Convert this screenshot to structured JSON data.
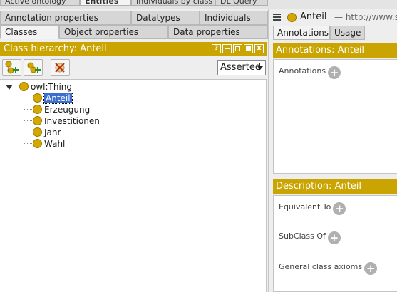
{
  "top_tabs": [
    "Active ontology",
    "Entities",
    "Individuals by class",
    "DL Query"
  ],
  "left": {
    "tabs_row1": [
      "Annotation properties",
      "Datatypes",
      "Individuals"
    ],
    "tabs_row2": [
      "Classes",
      "Object properties",
      "Data properties"
    ],
    "title": "Class hierarchy: Anteil",
    "title_icons": [
      "?",
      "",
      "",
      "",
      "x"
    ],
    "view_select": "Asserted",
    "tree": {
      "root": "owl:Thing",
      "children": [
        "Anteil",
        "Erzeugung",
        "Investitionen",
        "Jahr",
        "Wahl"
      ],
      "selected": "Anteil"
    }
  },
  "right": {
    "entity_name": "Anteil",
    "entity_iri": "— http://www.ser",
    "tabs": [
      "Annotations",
      "Usage"
    ],
    "annotations_title": "Annotations: Anteil",
    "annotations_label": "Annotations",
    "description_title": "Description: Anteil",
    "description_items": [
      "Equivalent To",
      "SubClass Of",
      "General class axioms"
    ]
  },
  "colors": {
    "accent": "#caa400",
    "class_icon": "#d4a800",
    "selection": "#3a6fcf"
  }
}
